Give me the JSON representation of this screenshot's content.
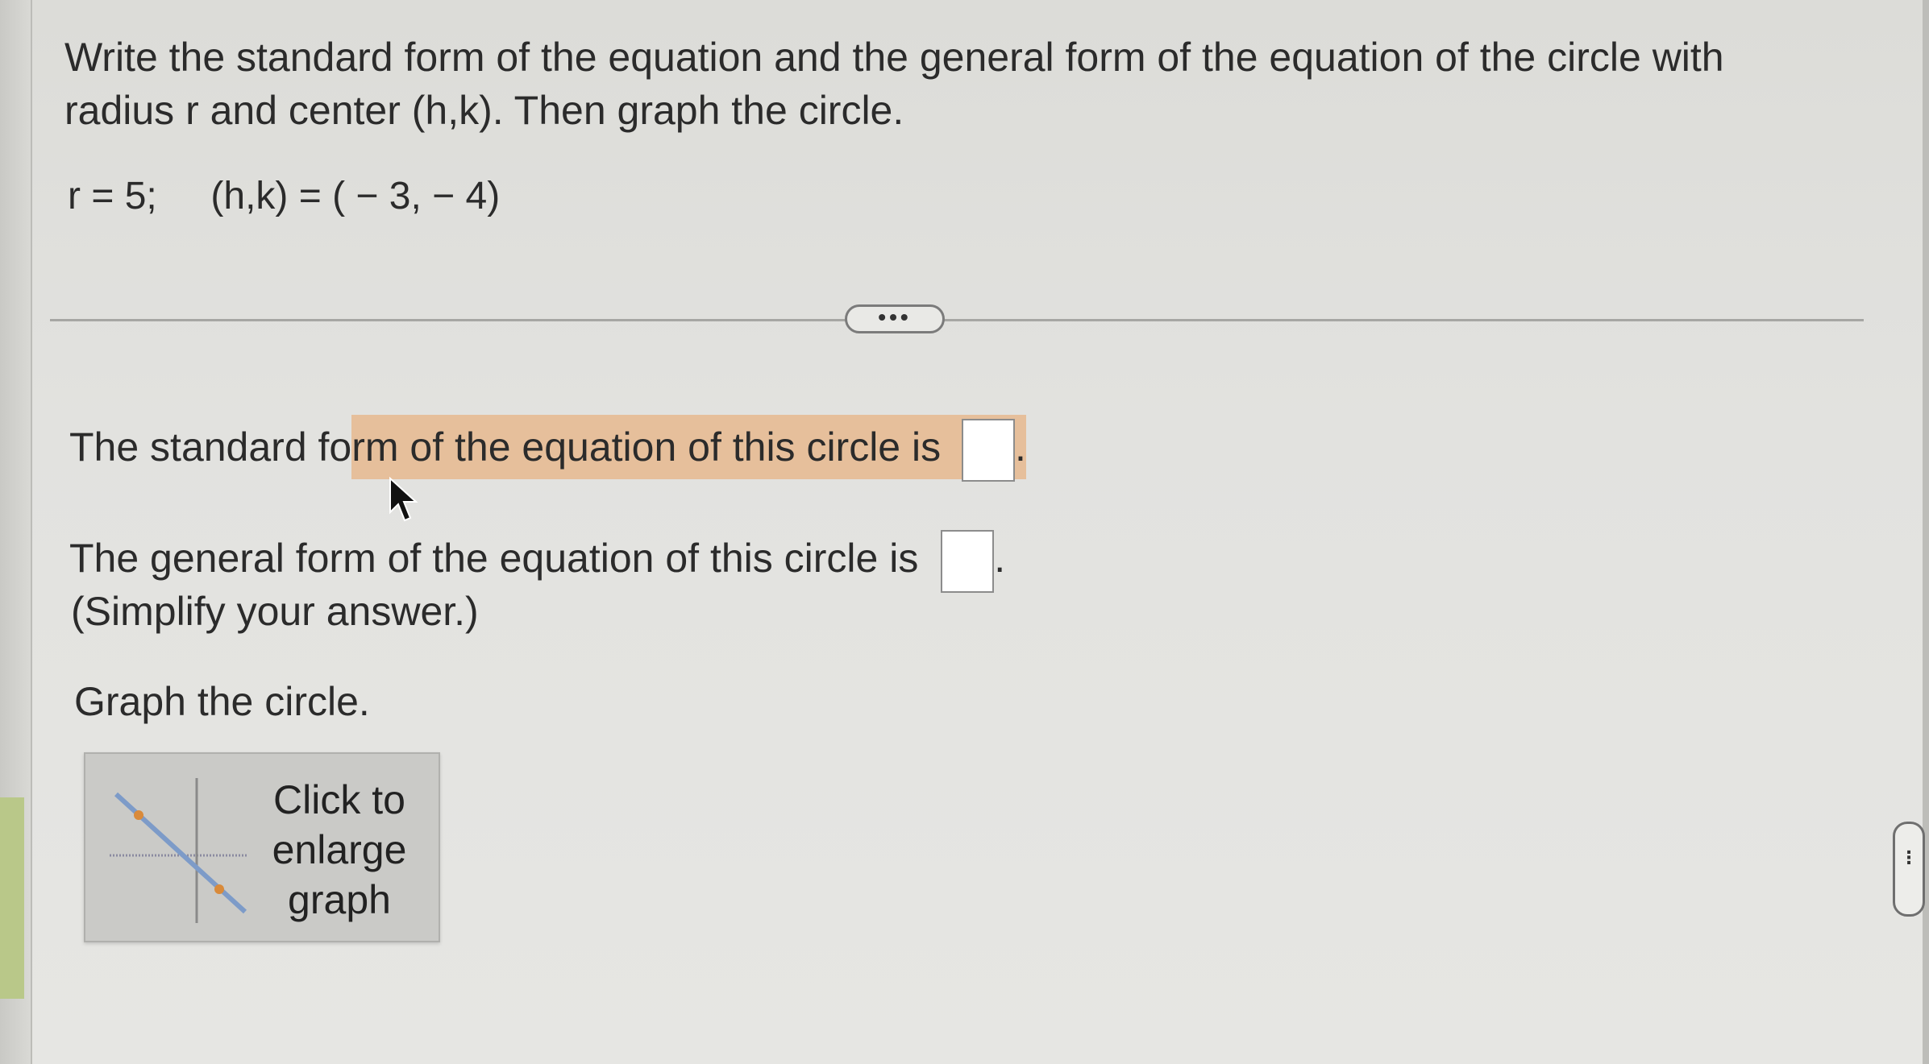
{
  "question": {
    "text": "Write the standard form of the equation and the general form of the equation of the circle with radius r and center (h,k). Then graph the circle.",
    "given": "r = 5;     (h,k) = ( − 3, − 4)"
  },
  "more_button": {
    "label": "•••"
  },
  "answers": {
    "standard_prefix": "The standard fo",
    "standard_highlight": "rm of the equation of this circle is",
    "standard_value": "",
    "general_text": "The general form of the equation of this circle is",
    "general_value": "",
    "simplify_note": "(Simplify your answer.)"
  },
  "graph": {
    "prompt": "Graph the circle.",
    "thumbnail_label": "Click to enlarge graph"
  },
  "side_handle": {
    "label": "⋮"
  },
  "colors": {
    "highlight": "#e6bf9b",
    "background": "#e2e2df",
    "text": "#2b2b2b"
  }
}
